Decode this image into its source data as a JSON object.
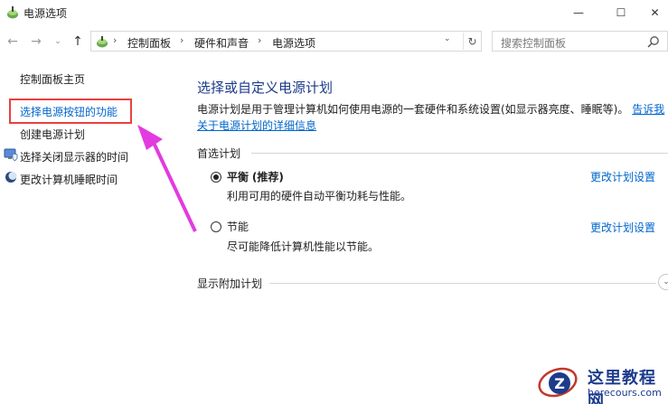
{
  "window": {
    "title": "电源选项",
    "minimize": "—",
    "maximize": "☐",
    "close": "✕"
  },
  "nav": {
    "back": "←",
    "forward": "→",
    "recent": "⌄",
    "up": "↑",
    "breadcrumbs": [
      "控制面板",
      "硬件和声音",
      "电源选项"
    ],
    "separator": "›",
    "refresh": "↻",
    "search_placeholder": "搜索控制面板"
  },
  "sidebar": {
    "items": [
      {
        "label": "控制面板主页"
      },
      {
        "label": "选择电源按钮的功能"
      },
      {
        "label": "创建电源计划"
      },
      {
        "label": "选择关闭显示器的时间"
      },
      {
        "label": "更改计算机睡眠时间"
      }
    ]
  },
  "main": {
    "title": "选择或自定义电源计划",
    "description_line1": "电源计划是用于管理计算机如何使用电源的一套硬件和系统设置(如显示器亮度、睡眠等)。",
    "description_link_a": "告诉我",
    "description_link_b": "关于电源计划的详细信息",
    "preferred_section": "首选计划",
    "plans": [
      {
        "name": "平衡",
        "tag": "(推荐)",
        "desc": "利用可用的硬件自动平衡功耗与性能。",
        "settings": "更改计划设置",
        "selected": true
      },
      {
        "name": "节能",
        "tag": "",
        "desc": "尽可能降低计算机性能以节能。",
        "settings": "更改计划设置",
        "selected": false
      }
    ],
    "additional_section": "显示附加计划",
    "expand": "⌄"
  },
  "watermark": {
    "title": "这里教程网",
    "url": "herecours.com"
  },
  "colors": {
    "link": "#0066cc",
    "title": "#1b3a8a",
    "highlight": "#e8413f",
    "arrow": "#e23be0"
  }
}
